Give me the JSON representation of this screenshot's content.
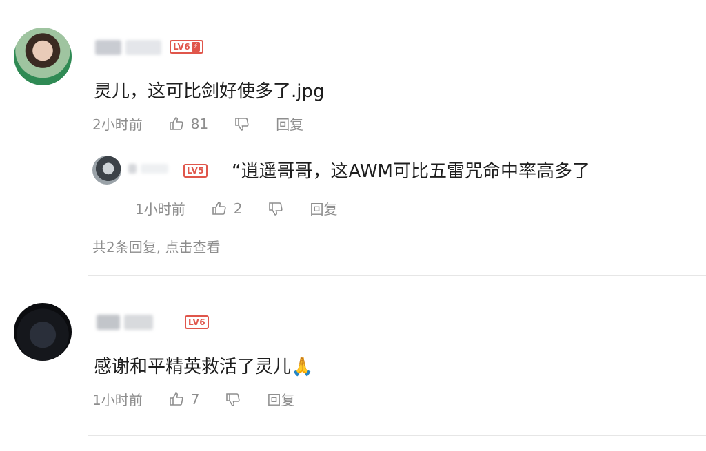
{
  "comments": [
    {
      "level": "LV6",
      "text": "灵儿，这可比剑好使多了.jpg",
      "time": "2小时前",
      "likes": "81",
      "reply_label": "回复",
      "more_replies": "共2条回复, 点击查看",
      "sub_reply": {
        "level": "LV5",
        "text": "“逍遥哥哥，这AWM可比五雷咒命中率高多了",
        "time": "1小时前",
        "likes": "2",
        "reply_label": "回复"
      }
    },
    {
      "level": "LV6",
      "text": "感谢和平精英救活了灵儿🙏",
      "time": "1小时前",
      "likes": "7",
      "reply_label": "回复"
    }
  ],
  "colors": {
    "level_badge": "#e0564b",
    "meta_text": "#8e8e8e",
    "divider": "#e6e6e6"
  },
  "icons": [
    "thumb-up-icon",
    "thumb-down-icon",
    "lightning-icon"
  ]
}
